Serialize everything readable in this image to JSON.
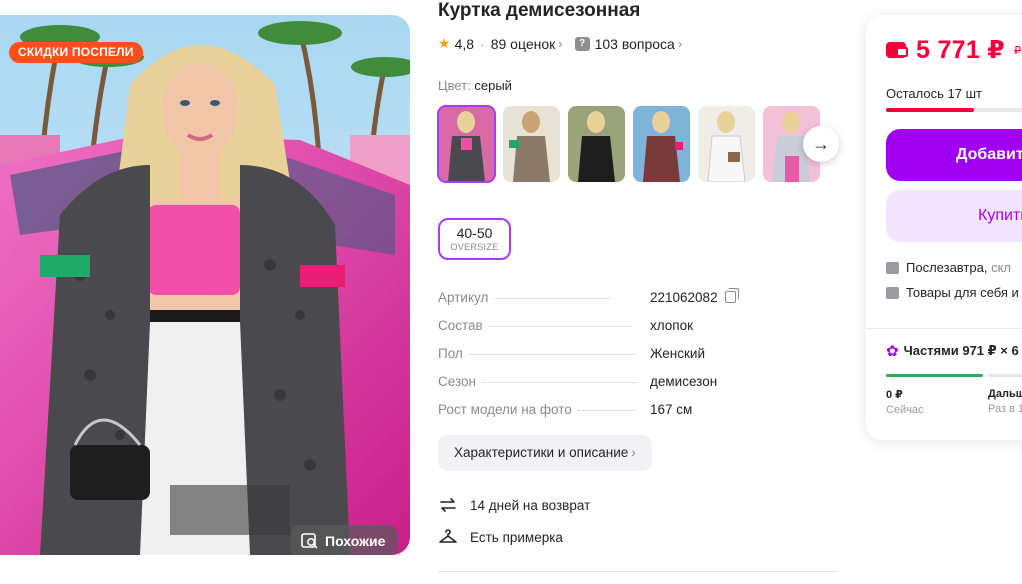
{
  "product": {
    "title": "Куртка демисезонная",
    "rating": "4,8",
    "reviews": "89 оценок",
    "questions": "103 вопроса",
    "color_label": "Цвет:",
    "color_value": "серый",
    "sale_badge": "СКИДКИ ПОСПЕЛИ",
    "similar_button": "Похожие",
    "thumbnails": [
      {
        "name": "thumb-1",
        "active": true
      },
      {
        "name": "thumb-2",
        "active": false
      },
      {
        "name": "thumb-3",
        "active": false
      },
      {
        "name": "thumb-4",
        "active": false
      },
      {
        "name": "thumb-5",
        "active": false
      },
      {
        "name": "thumb-6",
        "active": false
      }
    ],
    "size": {
      "value": "40-50",
      "sub": "OVERSIZE"
    }
  },
  "specs": [
    {
      "key": "Артикул",
      "value": "221062082"
    },
    {
      "key": "Состав",
      "value": "хлопок"
    },
    {
      "key": "Пол",
      "value": "Женский"
    },
    {
      "key": "Сезон",
      "value": "демисезон"
    },
    {
      "key": "Рост модели на фото",
      "value": "167 см"
    }
  ],
  "description_button": "Характеристики и описание",
  "features": {
    "returns": "14 дней на возврат",
    "fitting": "Есть примерка"
  },
  "buy": {
    "price": "5 771 ₽",
    "old_price": "₽",
    "stock_text": "Осталось 17 шт",
    "stock_level_percent": 55,
    "add_to_cart": "Добавить в корзину",
    "buy_now": "Купить сейчас",
    "delivery": "Послезавтра,",
    "delivery_extra": "скл",
    "goods_for": "Товары для себя и",
    "installments": "Частями 971 ₽ × 6",
    "part_now_amount": "0 ₽",
    "part_now_label": "Сейчас",
    "part_later_amount": "Дальш",
    "part_later_label": "Раз в 1"
  },
  "colors": {
    "accent": "#a100f0",
    "price_red": "#f5003a",
    "sale_orange": "#ff4d1c",
    "green": "#23b160"
  }
}
